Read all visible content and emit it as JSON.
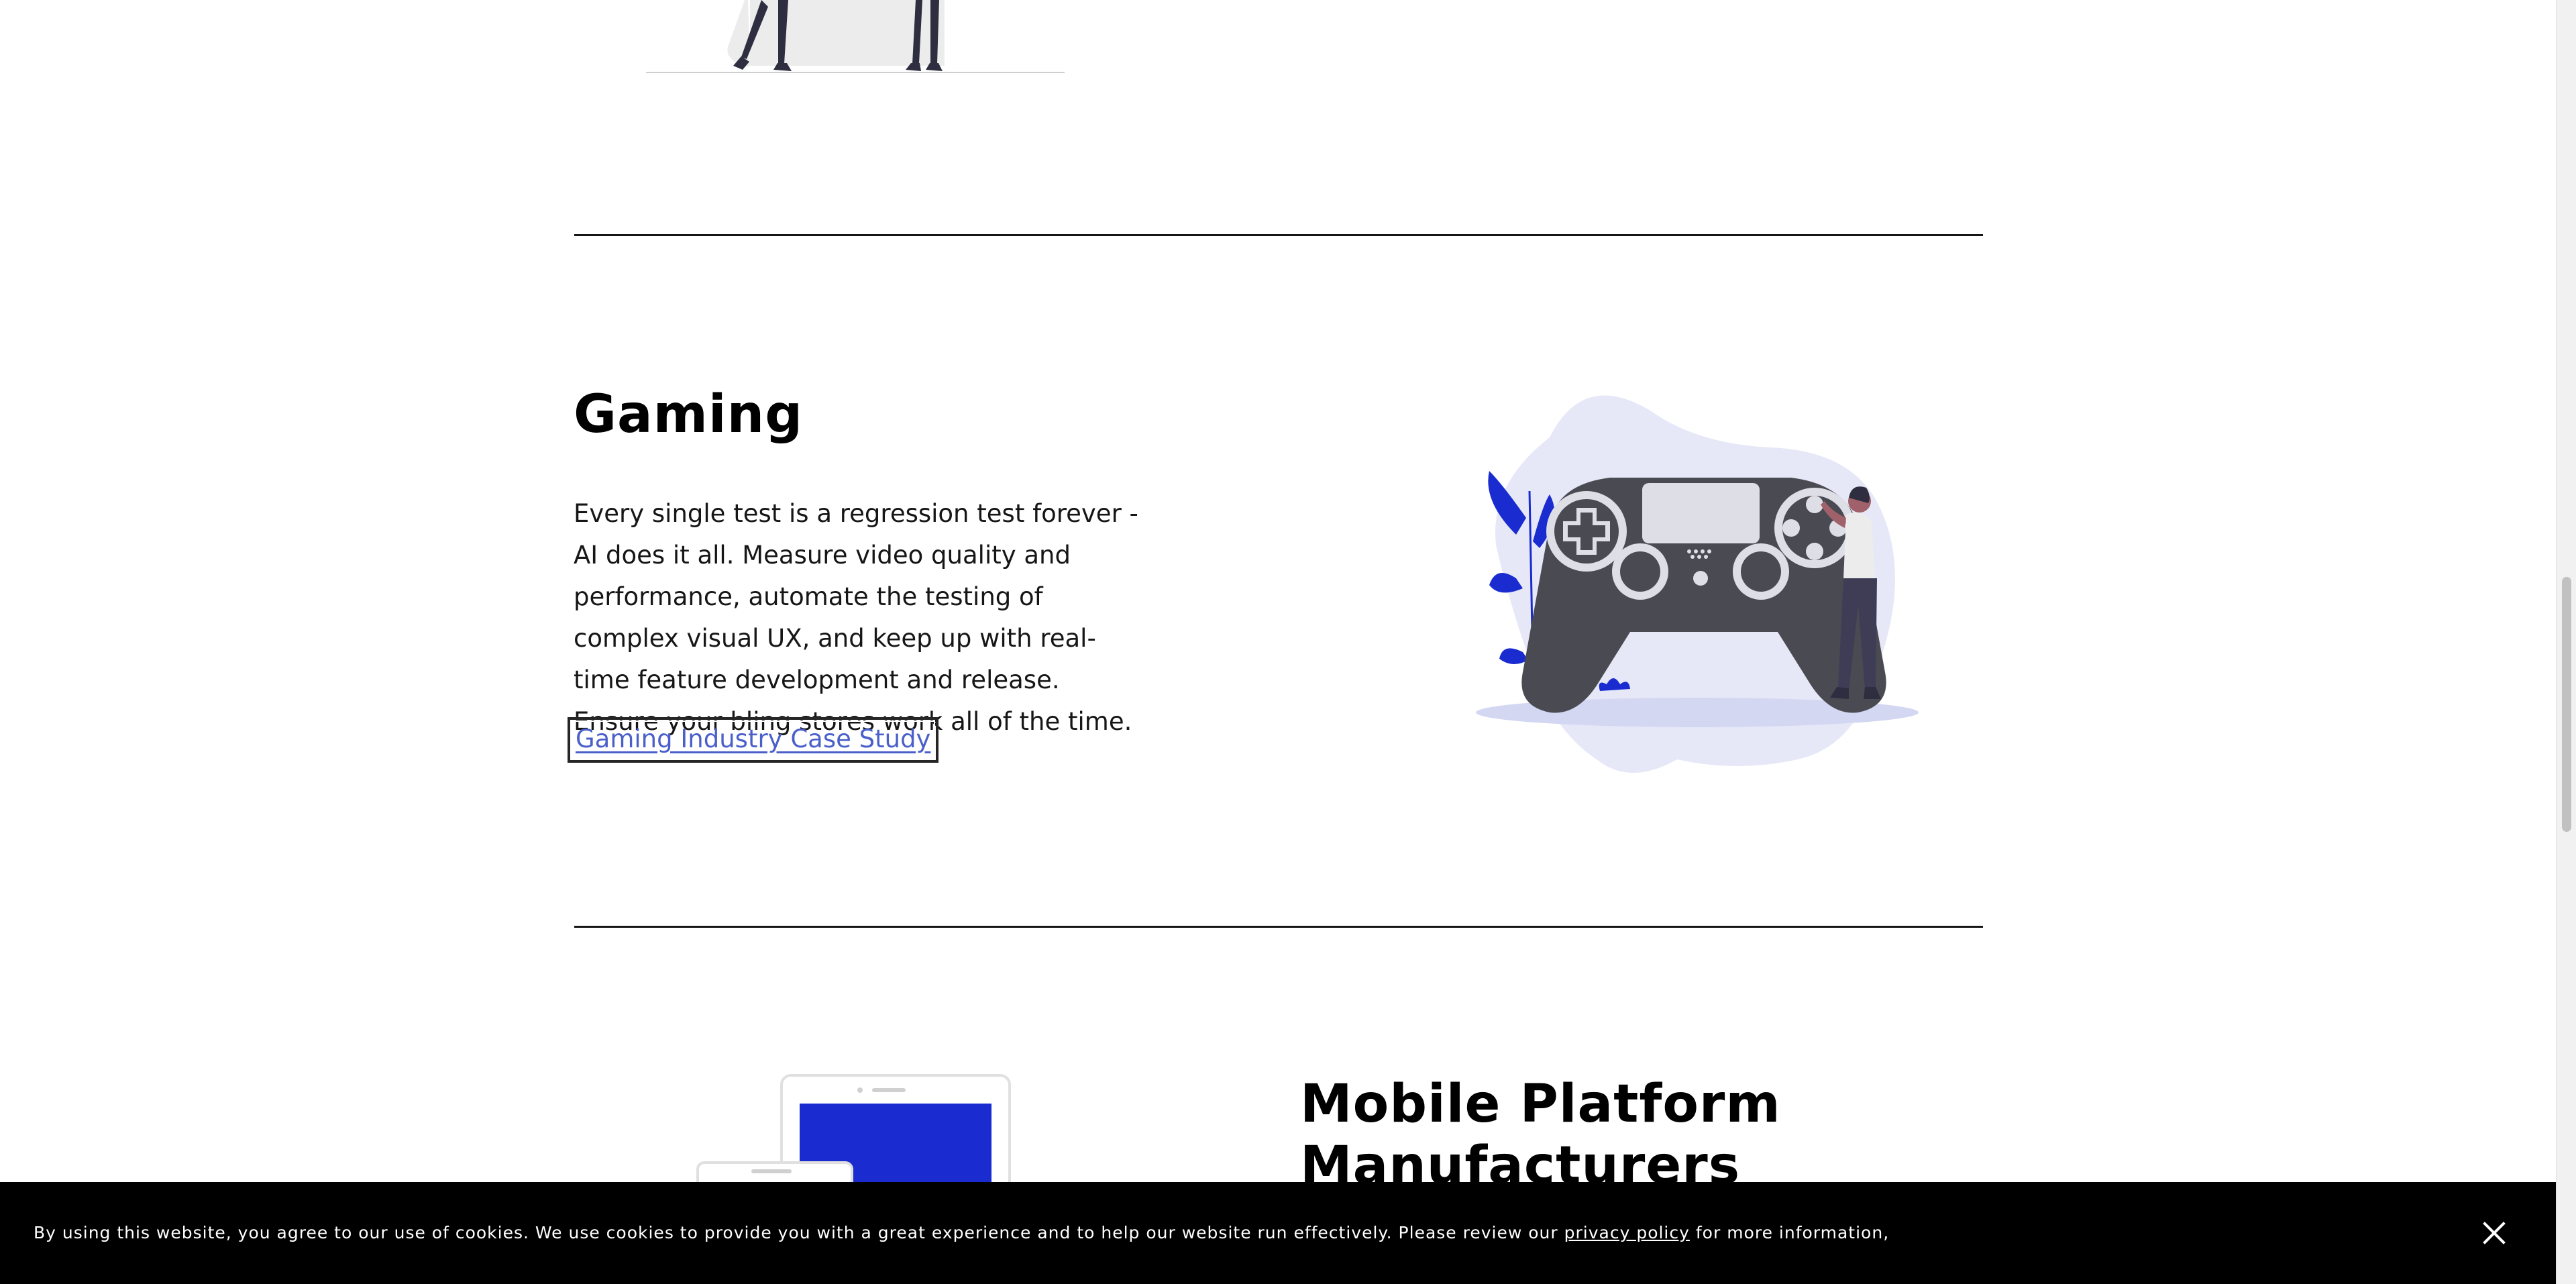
{
  "gaming": {
    "title": "Gaming",
    "description": "Every single test is a regression test forever - AI does it all. Measure video quality and performance, automate the testing of complex visual UX, and keep up with real-time feature development and release. Ensure your bling stores work all of the time.",
    "case_study_link": "Gaming Industry Case Study"
  },
  "mobile": {
    "title": "Mobile Platform Manufacturers"
  },
  "cookie_banner": {
    "text_before": "By using this website, you agree to our use of cookies. We use cookies to provide you with a great experience and to help our website run effectively. Please review our",
    "link": "privacy policy",
    "text_after": "for more information,"
  },
  "icons": {
    "close": "close-icon",
    "gaming_illustration": "game-controller-illustration",
    "mobile_illustration": "mobile-devices-illustration"
  },
  "colors": {
    "accent_blue": "#1a2ccf",
    "link": "#4a5fc9",
    "blob": "#e6e8f8",
    "controller": "#4a4a52"
  }
}
